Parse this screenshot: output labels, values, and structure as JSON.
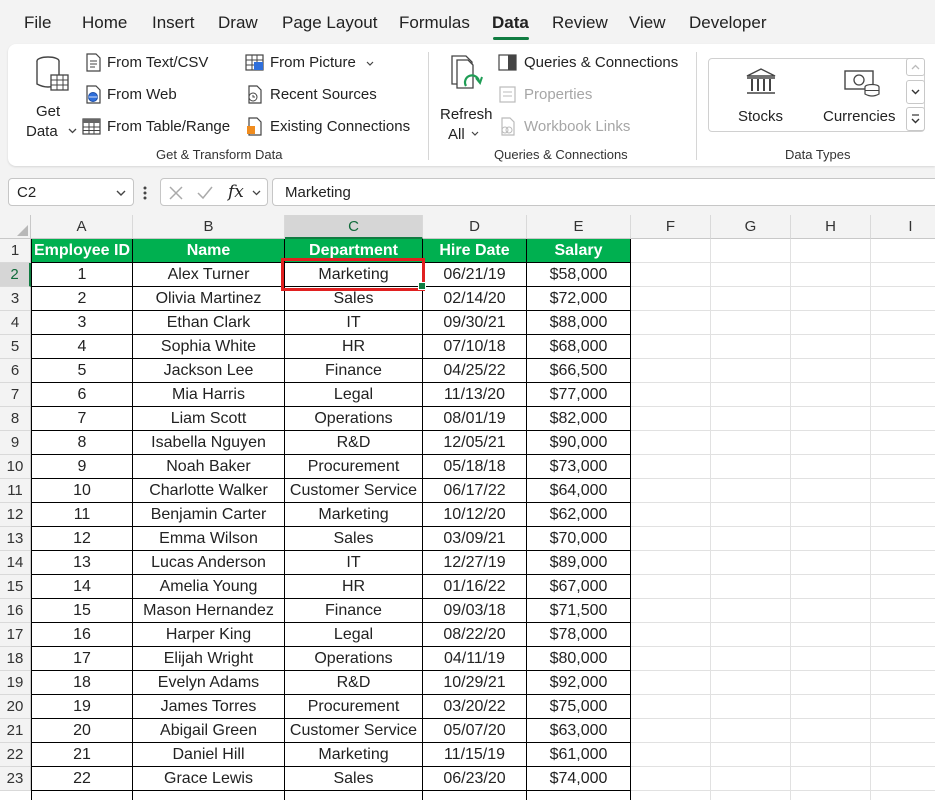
{
  "menu": {
    "items": [
      "File",
      "Home",
      "Insert",
      "Draw",
      "Page Layout",
      "Formulas",
      "Data",
      "Review",
      "View",
      "Developer"
    ],
    "active": "Data"
  },
  "ribbon": {
    "get_data": {
      "line1": "Get",
      "line2": "Data"
    },
    "from_text_csv": "From Text/CSV",
    "from_web": "From Web",
    "from_table_range": "From Table/Range",
    "from_picture": "From Picture",
    "recent_sources": "Recent Sources",
    "existing_connections": "Existing Connections",
    "group_get_transform": "Get & Transform Data",
    "refresh_all": {
      "line1": "Refresh",
      "line2": "All"
    },
    "queries_connections": "Queries & Connections",
    "properties": "Properties",
    "workbook_links": "Workbook Links",
    "group_queries": "Queries & Connections",
    "stocks": "Stocks",
    "currencies": "Currencies",
    "group_data_types": "Data Types"
  },
  "formula_bar": {
    "name_box": "C2",
    "fx": "fx",
    "value": "Marketing"
  },
  "sheet": {
    "columns": [
      "A",
      "B",
      "C",
      "D",
      "E",
      "F",
      "G",
      "H",
      "I"
    ],
    "row_numbers": [
      "1",
      "2",
      "3",
      "4",
      "5",
      "6",
      "7",
      "8",
      "9",
      "10",
      "11",
      "12",
      "13",
      "14",
      "15",
      "16",
      "17",
      "18",
      "19",
      "20",
      "21",
      "22",
      "23"
    ],
    "selected_cell": "C2",
    "header_fill": "#00b050",
    "selection_color": "#e02020",
    "headers": [
      "Employee ID",
      "Name",
      "Department",
      "Hire Date",
      "Salary"
    ],
    "rows": [
      [
        "1",
        "Alex Turner",
        "Marketing",
        "06/21/19",
        "$58,000"
      ],
      [
        "2",
        "Olivia Martinez",
        "Sales",
        "02/14/20",
        "$72,000"
      ],
      [
        "3",
        "Ethan Clark",
        "IT",
        "09/30/21",
        "$88,000"
      ],
      [
        "4",
        "Sophia White",
        "HR",
        "07/10/18",
        "$68,000"
      ],
      [
        "5",
        "Jackson Lee",
        "Finance",
        "04/25/22",
        "$66,500"
      ],
      [
        "6",
        "Mia Harris",
        "Legal",
        "11/13/20",
        "$77,000"
      ],
      [
        "7",
        "Liam Scott",
        "Operations",
        "08/01/19",
        "$82,000"
      ],
      [
        "8",
        "Isabella Nguyen",
        "R&D",
        "12/05/21",
        "$90,000"
      ],
      [
        "9",
        "Noah Baker",
        "Procurement",
        "05/18/18",
        "$73,000"
      ],
      [
        "10",
        "Charlotte Walker",
        "Customer Service",
        "06/17/22",
        "$64,000"
      ],
      [
        "11",
        "Benjamin Carter",
        "Marketing",
        "10/12/20",
        "$62,000"
      ],
      [
        "12",
        "Emma Wilson",
        "Sales",
        "03/09/21",
        "$70,000"
      ],
      [
        "13",
        "Lucas Anderson",
        "IT",
        "12/27/19",
        "$89,000"
      ],
      [
        "14",
        "Amelia Young",
        "HR",
        "01/16/22",
        "$67,000"
      ],
      [
        "15",
        "Mason Hernandez",
        "Finance",
        "09/03/18",
        "$71,500"
      ],
      [
        "16",
        "Harper King",
        "Legal",
        "08/22/20",
        "$78,000"
      ],
      [
        "17",
        "Elijah Wright",
        "Operations",
        "04/11/19",
        "$80,000"
      ],
      [
        "18",
        "Evelyn Adams",
        "R&D",
        "10/29/21",
        "$92,000"
      ],
      [
        "19",
        "James Torres",
        "Procurement",
        "03/20/22",
        "$75,000"
      ],
      [
        "20",
        "Abigail Green",
        "Customer Service",
        "05/07/20",
        "$63,000"
      ],
      [
        "21",
        "Daniel Hill",
        "Marketing",
        "11/15/19",
        "$61,000"
      ],
      [
        "22",
        "Grace Lewis",
        "Sales",
        "06/23/20",
        "$74,000"
      ]
    ]
  }
}
